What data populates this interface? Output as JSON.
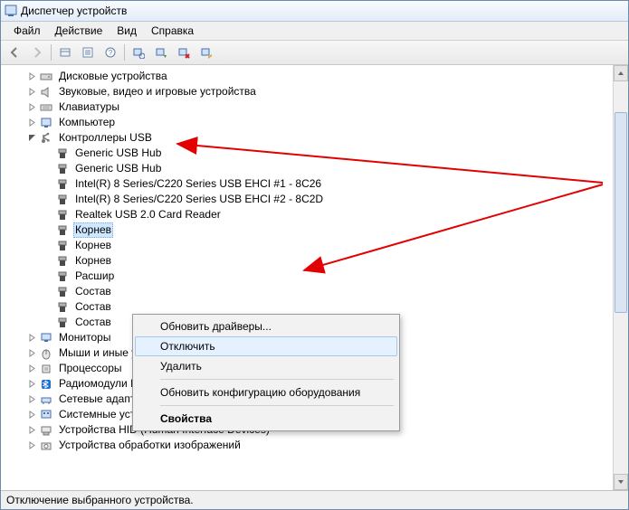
{
  "window_title": "Диспетчер устройств",
  "menus": {
    "file": "Файл",
    "action": "Действие",
    "view": "Вид",
    "help": "Справка"
  },
  "tree": {
    "top_categories": [
      {
        "label": "Дисковые устройства",
        "icon": "disk"
      },
      {
        "label": "Звуковые, видео и игровые устройства",
        "icon": "audio"
      },
      {
        "label": "Клавиатуры",
        "icon": "keyboard"
      },
      {
        "label": "Компьютер",
        "icon": "computer"
      }
    ],
    "usb_category_label": "Контроллеры USB",
    "usb_children": [
      {
        "label": "Generic USB Hub"
      },
      {
        "label": "Generic USB Hub"
      },
      {
        "label": "Intel(R) 8 Series/C220 Series USB EHCI #1 - 8C26"
      },
      {
        "label": "Intel(R) 8 Series/C220 Series USB EHCI #2 - 8C2D"
      },
      {
        "label": "Realtek USB 2.0 Card Reader"
      },
      {
        "label": "Корнев",
        "selected": true
      },
      {
        "label": "Корнев"
      },
      {
        "label": "Корнев"
      },
      {
        "label": "Расшир"
      },
      {
        "label": "Состав"
      },
      {
        "label": "Состав"
      },
      {
        "label": "Состав"
      }
    ],
    "bottom_categories": [
      {
        "label": "Мониторы",
        "icon": "monitor"
      },
      {
        "label": "Мыши и иные указывающие устройства",
        "icon": "mouse"
      },
      {
        "label": "Процессоры",
        "icon": "cpu"
      },
      {
        "label": "Радиомодули Bluetooth",
        "icon": "bluetooth"
      },
      {
        "label": "Сетевые адаптеры",
        "icon": "network"
      },
      {
        "label": "Системные устройства",
        "icon": "system"
      },
      {
        "label": "Устройства HID (Human Interface Devices)",
        "icon": "hid"
      },
      {
        "label": "Устройства обработки изображений",
        "icon": "imaging"
      }
    ]
  },
  "context_menu": {
    "update_drivers": "Обновить драйверы...",
    "disable": "Отключить",
    "delete": "Удалить",
    "scan_hardware": "Обновить конфигурацию оборудования",
    "properties": "Свойства"
  },
  "statusbar": "Отключение выбранного устройства."
}
